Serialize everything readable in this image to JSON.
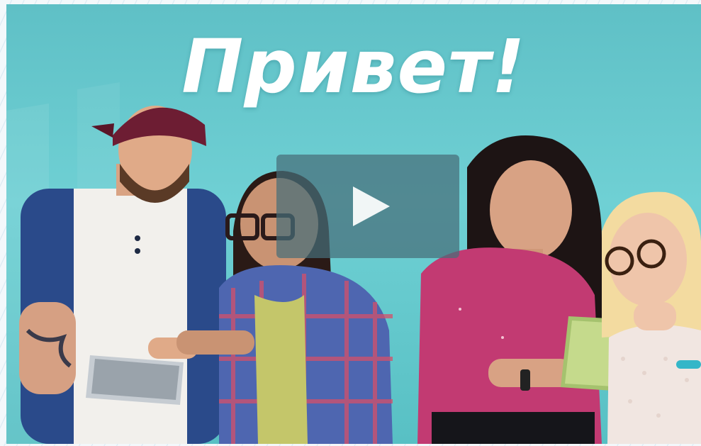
{
  "video": {
    "title": "Привет!",
    "play_icon": "play-icon",
    "colors": {
      "background": "#6fd0d4",
      "play_overlay": "#466e78",
      "title": "#ffffff"
    }
  }
}
